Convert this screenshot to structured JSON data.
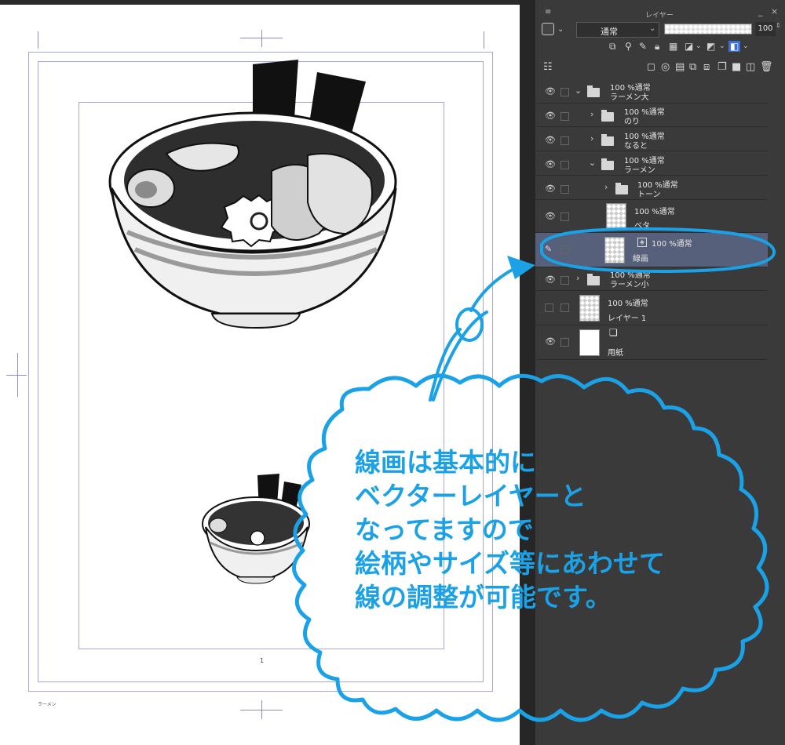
{
  "canvas": {
    "page_number": "1",
    "corner_label": "ラーメン"
  },
  "panel": {
    "title": "レイヤー",
    "minimize_glyph": "_",
    "close_glyph": "×",
    "blend_mode": "通常",
    "opacity": "100",
    "opacity_fraction": 1.0
  },
  "layers": [
    {
      "line1": "100 %通常",
      "line2": "ラーメン大"
    },
    {
      "line1": "100 %通常",
      "line2": "のり"
    },
    {
      "line1": "100 %通常",
      "line2": "なると"
    },
    {
      "line1": "100 %通常",
      "line2": "ラーメン"
    },
    {
      "line1": "100 %通常",
      "line2": "トーン"
    },
    {
      "line1": "100 %通常",
      "line2": "ベタ"
    },
    {
      "line1": "100 %通常",
      "line2": "線画"
    },
    {
      "line1": "100 %通常",
      "line2": "ラーメン小"
    },
    {
      "line1": "100 %通常",
      "line2": "レイヤー 1"
    },
    {
      "line1": "",
      "line2": "用紙"
    }
  ],
  "annotation": {
    "lines": [
      "線画は基本的に",
      "ベクターレイヤーと",
      "なってますので",
      "絵柄やサイズ等にあわせて",
      "線の調整が可能です。"
    ],
    "color": "#1ba1e6"
  },
  "colors": {
    "panel_bg": "#3a3a3a",
    "selected_layer": "#57607a",
    "guide": "#a7a7d6"
  }
}
